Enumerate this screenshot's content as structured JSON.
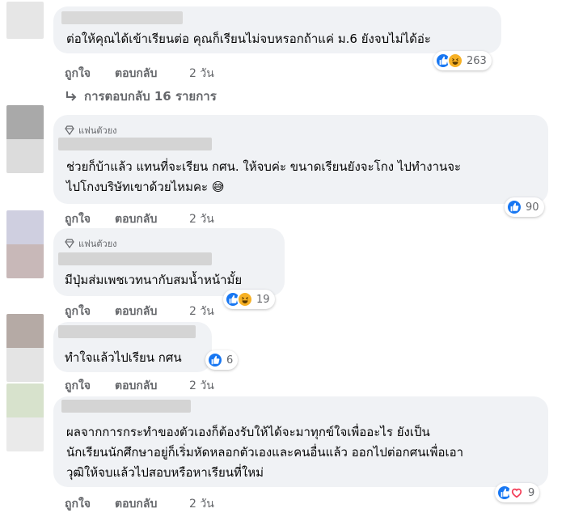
{
  "comments": [
    {
      "text_lines": [
        "ต่อให้คุณได้เข้าเรียนต่อ คุณก็เรียนไม่จบหรอกถ้าแค่ ม.6 ยังจบไม่ได้อ่ะ"
      ],
      "actions": {
        "like": "ถูกใจ",
        "reply": "ตอบกลับ",
        "time": "2 วัน"
      },
      "reactions": {
        "types": [
          "like-icon",
          "haha-icon"
        ],
        "count": "263"
      }
    },
    {
      "badge": "แฟนตัวยง",
      "text_lines": [
        "ช่วยก็บ้าแล้ว แทนที่จะเรียน กศน. ให้จบค่ะ ขนาดเรียนยังจะโกง ไปทำงานจะ",
        "ไปโกงบริษัทเขาด้วยไหมคะ 😅"
      ],
      "actions": {
        "like": "ถูกใจ",
        "reply": "ตอบกลับ",
        "time": "2 วัน"
      },
      "reactions": {
        "types": [
          "like-icon"
        ],
        "count": "90"
      }
    },
    {
      "badge": "แฟนตัวยง",
      "text_lines": [
        "มีปุ่มส่มเพชเวทนากับสมน้ำหน้ามั้ย"
      ],
      "actions": {
        "like": "ถูกใจ",
        "reply": "ตอบกลับ",
        "time": "2 วัน"
      },
      "reactions": {
        "types": [
          "like-icon",
          "haha-icon"
        ],
        "count": "19"
      }
    },
    {
      "text_lines": [
        "ทำใจแล้วไปเรียน กศน"
      ],
      "actions": {
        "like": "ถูกใจ",
        "reply": "ตอบกลับ",
        "time": "2 วัน"
      },
      "reactions": {
        "types": [
          "like-icon"
        ],
        "count": "6"
      }
    },
    {
      "text_lines": [
        "ผลจากการกระทำของตัวเองก็ต้องรับให้ได้จะมาทุกข์ใจเพื่ออะไร ยังเป็น",
        "นักเรียนนักศึกษาอยู่ก็เริ่มหัดหลอกตัวเองและคนอื่นแล้ว ออกไปต่อกศนเพื่อเอา",
        "วุฒิให้จบแล้วไปสอบหรือหาเรียนที่ใหม่"
      ],
      "actions": {
        "like": "ถูกใจ",
        "reply": "ตอบกลับ",
        "time": "2 วัน"
      },
      "reactions": {
        "types": [
          "like-icon",
          "love-icon"
        ],
        "count": "9"
      }
    }
  ],
  "view_replies": {
    "label": "การตอบกลับ 16 รายการ",
    "icon": "reply-arrow-icon"
  },
  "colors": {
    "bubble": "#f0f2f5",
    "secondary_text": "#65676b",
    "like_blue": "#1877f2",
    "haha_yellow": "#f7b125",
    "love_red": "#f33e58"
  }
}
